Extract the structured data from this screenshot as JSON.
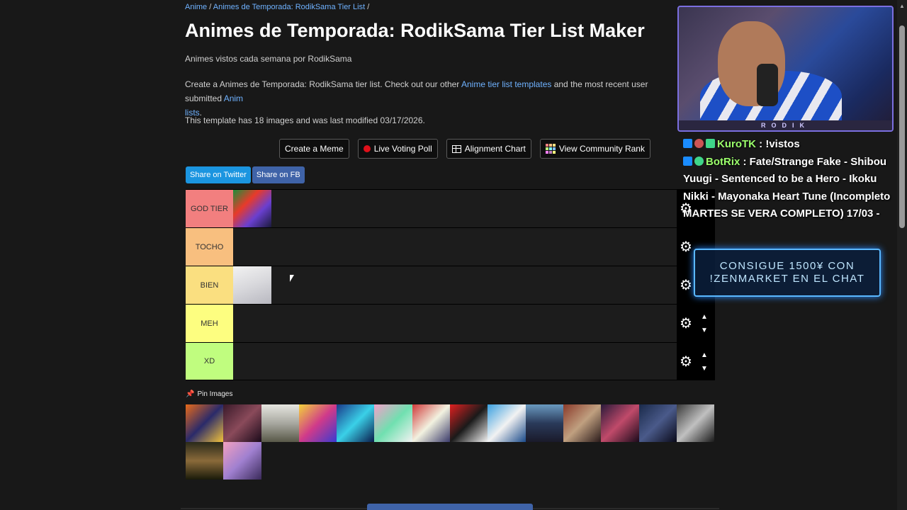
{
  "breadcrumb": {
    "item1": "Anime",
    "sep1": " / ",
    "item2": "Animes de Temporada: RodikSama Tier List",
    "sep2": " /"
  },
  "header": {
    "title": "Animes de Temporada: RodikSama Tier List Maker",
    "subtitle": "Animes vistos cada semana por RodikSama",
    "desc_pre": "Create a Animes de Temporada: RodikSama tier list. Check out our other ",
    "desc_link1": "Anime tier list templates",
    "desc_mid": " and the most recent user submitted ",
    "desc_link2": "Anim",
    "desc_link2b": "lists",
    "desc_end": ".",
    "meta": "This template has 18 images and was last modified 03/17/2026."
  },
  "actions": {
    "create_meme": "Create a Meme",
    "live_poll": "Live Voting Poll",
    "alignment": "Alignment Chart",
    "community": "View Community Rank"
  },
  "share": {
    "twitter": "Share on Twitter",
    "fb": "Share on FB"
  },
  "tiers": [
    {
      "label": "GOD TIER",
      "color": "#f27f7f"
    },
    {
      "label": "TOCHO",
      "color": "#f8bf7f"
    },
    {
      "label": "BIEN",
      "color": "#fadf80"
    },
    {
      "label": "MEH",
      "color": "#fdfe80"
    },
    {
      "label": "XD",
      "color": "#c0fd7f"
    }
  ],
  "pin_images": "Pin Images",
  "stream": {
    "cam_name": "RODIK",
    "chat": [
      {
        "user": "KuroTK",
        "text": " : !vistos"
      },
      {
        "user": "BotRix",
        "text": " : Fate/Strange Fake - Shibou Yuugi - Sentenced to be a Hero - Ikoku Nikki - Mayonaka Heart Tune (Incompleto MARTES SE VERA COMPLETO) 17/03 -"
      }
    ],
    "promo_line1": "CONSIGUE 1500¥ CON",
    "promo_line2": "!ZENMARKET EN EL CHAT"
  }
}
